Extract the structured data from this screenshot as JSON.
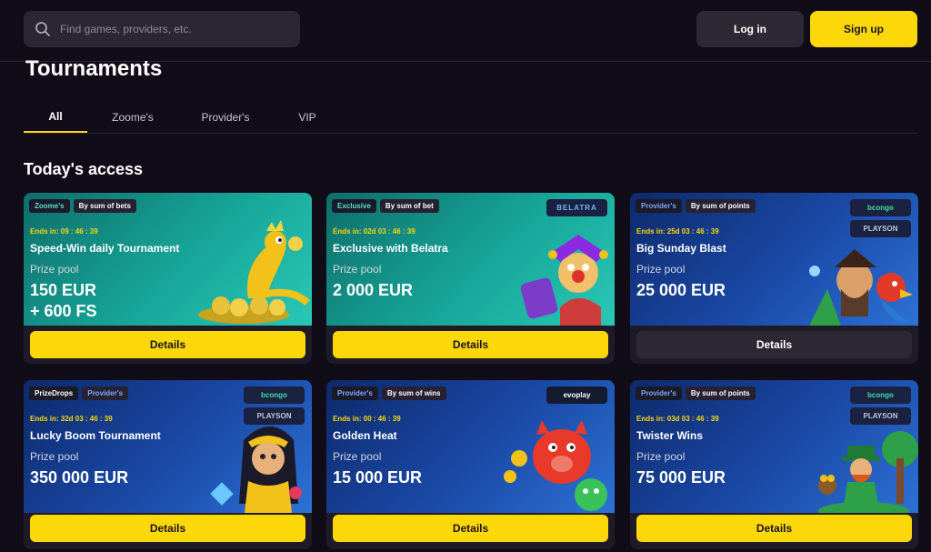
{
  "header": {
    "search_placeholder": "Find games, providers, etc.",
    "login_label": "Log in",
    "signup_label": "Sign up"
  },
  "page_title": "Tournaments",
  "tabs": [
    {
      "label": "All",
      "active": true
    },
    {
      "label": "Zoome's",
      "active": false
    },
    {
      "label": "Provider's",
      "active": false
    },
    {
      "label": "VIP",
      "active": false
    }
  ],
  "section_title": "Today's access",
  "cards": [
    {
      "tags": [
        "Zoome's",
        "By sum of bets"
      ],
      "ends": "Ends in: 09 : 46 : 39",
      "name": "Speed-Win daily Tournament",
      "pool_label": "Prize pool",
      "pool_line1": "150 EUR",
      "pool_line2": "+ 600 FS",
      "logos": [],
      "details_label": "Details"
    },
    {
      "tags": [
        "Exclusive",
        "By sum of bet"
      ],
      "ends": "Ends in: 02d 03 : 46 : 39",
      "name": "Exclusive with Belatra",
      "pool_label": "Prize pool",
      "pool_line1": "2 000 EUR",
      "logos": [
        "BELATRA"
      ],
      "details_label": "Details"
    },
    {
      "tags": [
        "Provider's",
        "By sum of points"
      ],
      "ends": "Ends in: 25d 03 : 46 : 39",
      "name": "Big Sunday Blast",
      "pool_label": "Prize pool",
      "pool_line1": "25 000 EUR",
      "logos": [
        "bcongo",
        "PLAYSON"
      ],
      "details_label": "Details"
    },
    {
      "tags": [
        "PrizeDrops",
        "Provider's"
      ],
      "ends": "Ends in: 32d 03 : 46 : 39",
      "name": "Lucky Boom Tournament",
      "pool_label": "Prize pool",
      "pool_line1": "350 000 EUR",
      "logos": [
        "bcongo",
        "PLAYSON"
      ],
      "details_label": "Details"
    },
    {
      "tags": [
        "Provider's",
        "By sum of wins"
      ],
      "ends": "Ends in: 00 : 46 : 39",
      "name": "Golden Heat",
      "pool_label": "Prize pool",
      "pool_line1": "15 000 EUR",
      "logos": [
        "evoplay"
      ],
      "details_label": "Details"
    },
    {
      "tags": [
        "Provider's",
        "By sum of points"
      ],
      "ends": "Ends in: 03d 03 : 46 : 39",
      "name": "Twister Wins",
      "pool_label": "Prize pool",
      "pool_line1": "75 000 EUR",
      "logos": [
        "bcongo",
        "PLAYSON"
      ],
      "details_label": "Details"
    }
  ],
  "colors": {
    "background": "#100c18",
    "accent_yellow": "#fcd70a",
    "teal_banner": "#17a79a",
    "blue_banner": "#1b4aa8"
  }
}
